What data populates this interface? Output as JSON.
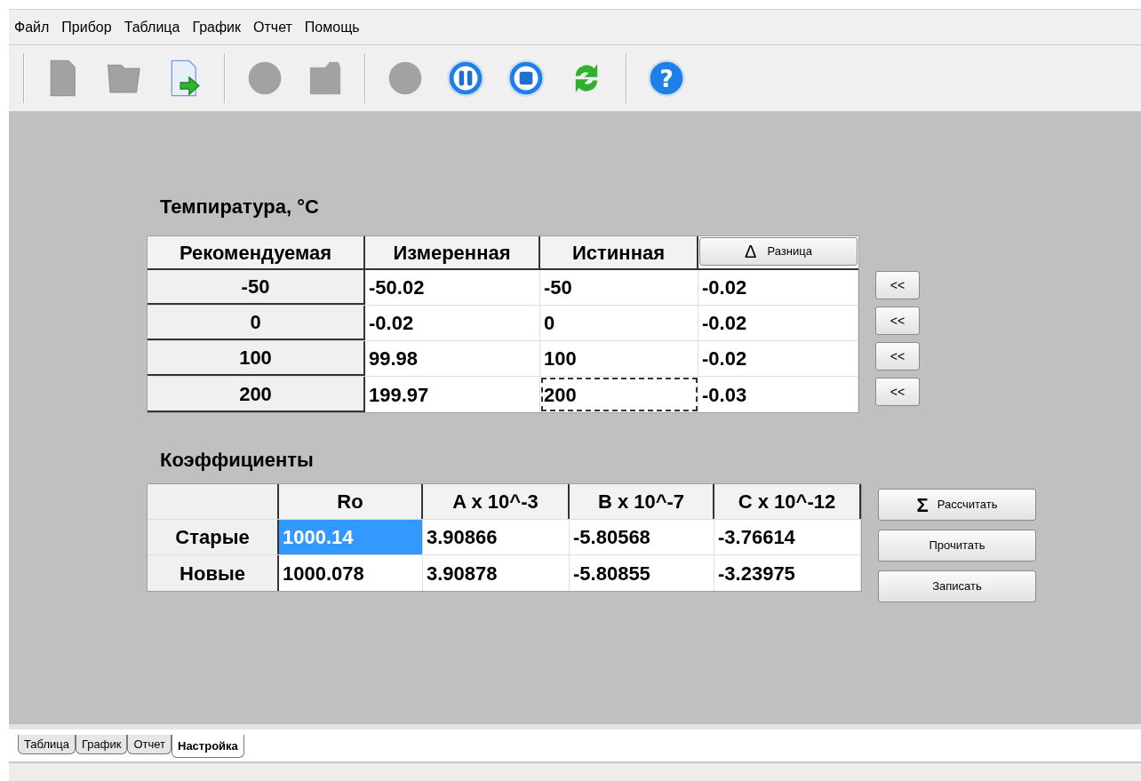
{
  "menu": [
    "Файл",
    "Прибор",
    "Таблица",
    "График",
    "Отчет",
    "Помощь"
  ],
  "toolbar": [
    [
      {
        "kind": "new",
        "disabled": true
      },
      {
        "kind": "open",
        "disabled": true
      },
      {
        "kind": "export",
        "disabled": false
      }
    ],
    [
      {
        "kind": "record",
        "disabled": true
      },
      {
        "kind": "save",
        "disabled": true
      }
    ],
    [
      {
        "kind": "start",
        "disabled": true
      },
      {
        "kind": "pause",
        "disabled": false
      },
      {
        "kind": "stop",
        "disabled": false
      },
      {
        "kind": "refresh",
        "disabled": false
      }
    ],
    [
      {
        "kind": "help",
        "disabled": false,
        "glyph": "?"
      }
    ]
  ],
  "temperature": {
    "title": "Темпиратура, °C",
    "columns": [
      "Рекомендуемая",
      "Измеренная",
      "Истинная"
    ],
    "diff_button": {
      "symbol": "Δ",
      "label": "Разница"
    },
    "rows": [
      {
        "header": "-50",
        "cells": [
          {
            "text": "-50.02",
            "focused": false
          },
          {
            "text": "-50",
            "focused": false
          },
          {
            "text": "-0.02",
            "focused": false
          }
        ],
        "button": "<<"
      },
      {
        "header": "0",
        "cells": [
          {
            "text": "-0.02",
            "focused": false
          },
          {
            "text": "0",
            "focused": false
          },
          {
            "text": "-0.02",
            "focused": false
          }
        ],
        "button": "<<"
      },
      {
        "header": "100",
        "cells": [
          {
            "text": "99.98",
            "focused": false
          },
          {
            "text": "100",
            "focused": false
          },
          {
            "text": "-0.02",
            "focused": false
          }
        ],
        "button": "<<"
      },
      {
        "header": "200",
        "cells": [
          {
            "text": "199.97",
            "focused": false
          },
          {
            "text": "200",
            "focused": true
          },
          {
            "text": "-0.03",
            "focused": false
          }
        ],
        "button": "<<"
      }
    ]
  },
  "coefficients": {
    "title": "Коэффициенты",
    "columns": [
      "Ro",
      "A x 10^-3",
      "B x 10^-7",
      "C x 10^-12"
    ],
    "rows": [
      {
        "header": "Старые",
        "cells": [
          {
            "text": "1000.14",
            "selected": true
          },
          {
            "text": "3.90866",
            "selected": false
          },
          {
            "text": "-5.80568",
            "selected": false
          },
          {
            "text": "-3.76614",
            "selected": false
          }
        ]
      },
      {
        "header": "Новые",
        "cells": [
          {
            "text": "1000.078",
            "selected": false
          },
          {
            "text": "3.90878",
            "selected": false
          },
          {
            "text": "-5.80855",
            "selected": false
          },
          {
            "text": "-3.23975",
            "selected": false
          }
        ]
      }
    ],
    "buttons": [
      {
        "symbol": "Σ",
        "label": "Рассчитать"
      },
      {
        "label": "Прочитать"
      },
      {
        "label": "Записать"
      }
    ]
  },
  "tabs": [
    {
      "label": "Таблица",
      "selected": false
    },
    {
      "label": "График",
      "selected": false
    },
    {
      "label": "Отчет",
      "selected": false
    },
    {
      "label": "Настройка",
      "selected": true
    }
  ]
}
